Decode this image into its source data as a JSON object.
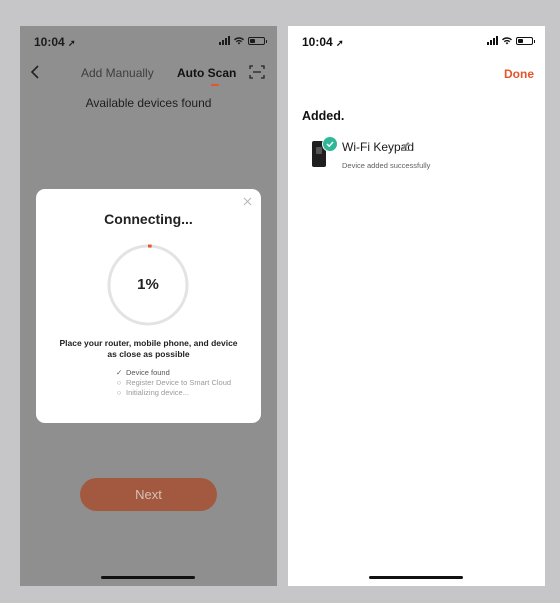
{
  "left_screen": {
    "status": {
      "time": "10:04",
      "location_icon": "location-arrow-icon"
    },
    "nav": {
      "back_icon": "chevron-left-icon",
      "tab_manual": "Add Manually",
      "tab_scan": "Auto Scan",
      "scan_icon": "scan-frame-icon"
    },
    "found_text": "Available devices found",
    "dialog": {
      "title": "Connecting...",
      "progress_percent": 1,
      "progress_label": "1%",
      "hint": "Place your router, mobile phone, and device as close as possible",
      "steps": [
        {
          "label": "Device found",
          "status": "done"
        },
        {
          "label": "Register Device to Smart Cloud",
          "status": "pending"
        },
        {
          "label": "Initializing device...",
          "status": "pending"
        }
      ]
    },
    "next_label": "Next"
  },
  "right_screen": {
    "status": {
      "time": "10:04"
    },
    "done_label": "Done",
    "added_heading": "Added.",
    "device": {
      "name": "Wi-Fi Keypad",
      "status": "Device added successfully"
    }
  },
  "colors": {
    "accent": "#e5552b",
    "success": "#2fb896",
    "next_button": "#a3593f"
  }
}
